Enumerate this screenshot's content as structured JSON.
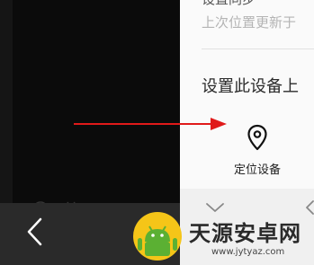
{
  "settings_panel": {
    "top_cut_text": "设置同步",
    "last_update_text": "上次位置更新于",
    "section_title": "设置此设备上",
    "locate_label": "定位设备"
  },
  "watermark": {
    "title": "天源安卓网",
    "url": "www.jytyaz.com"
  },
  "icons": {
    "locate": "map-pin-icon",
    "chevron_down": "chevron-down-icon",
    "chevron_left": "chevron-left-icon",
    "back": "back-chevron-icon",
    "logo": "android-logo-icon"
  },
  "colors": {
    "arrow": "#e01a1a",
    "logo_yellow": "#f5c518",
    "logo_green": "#5bb033"
  }
}
